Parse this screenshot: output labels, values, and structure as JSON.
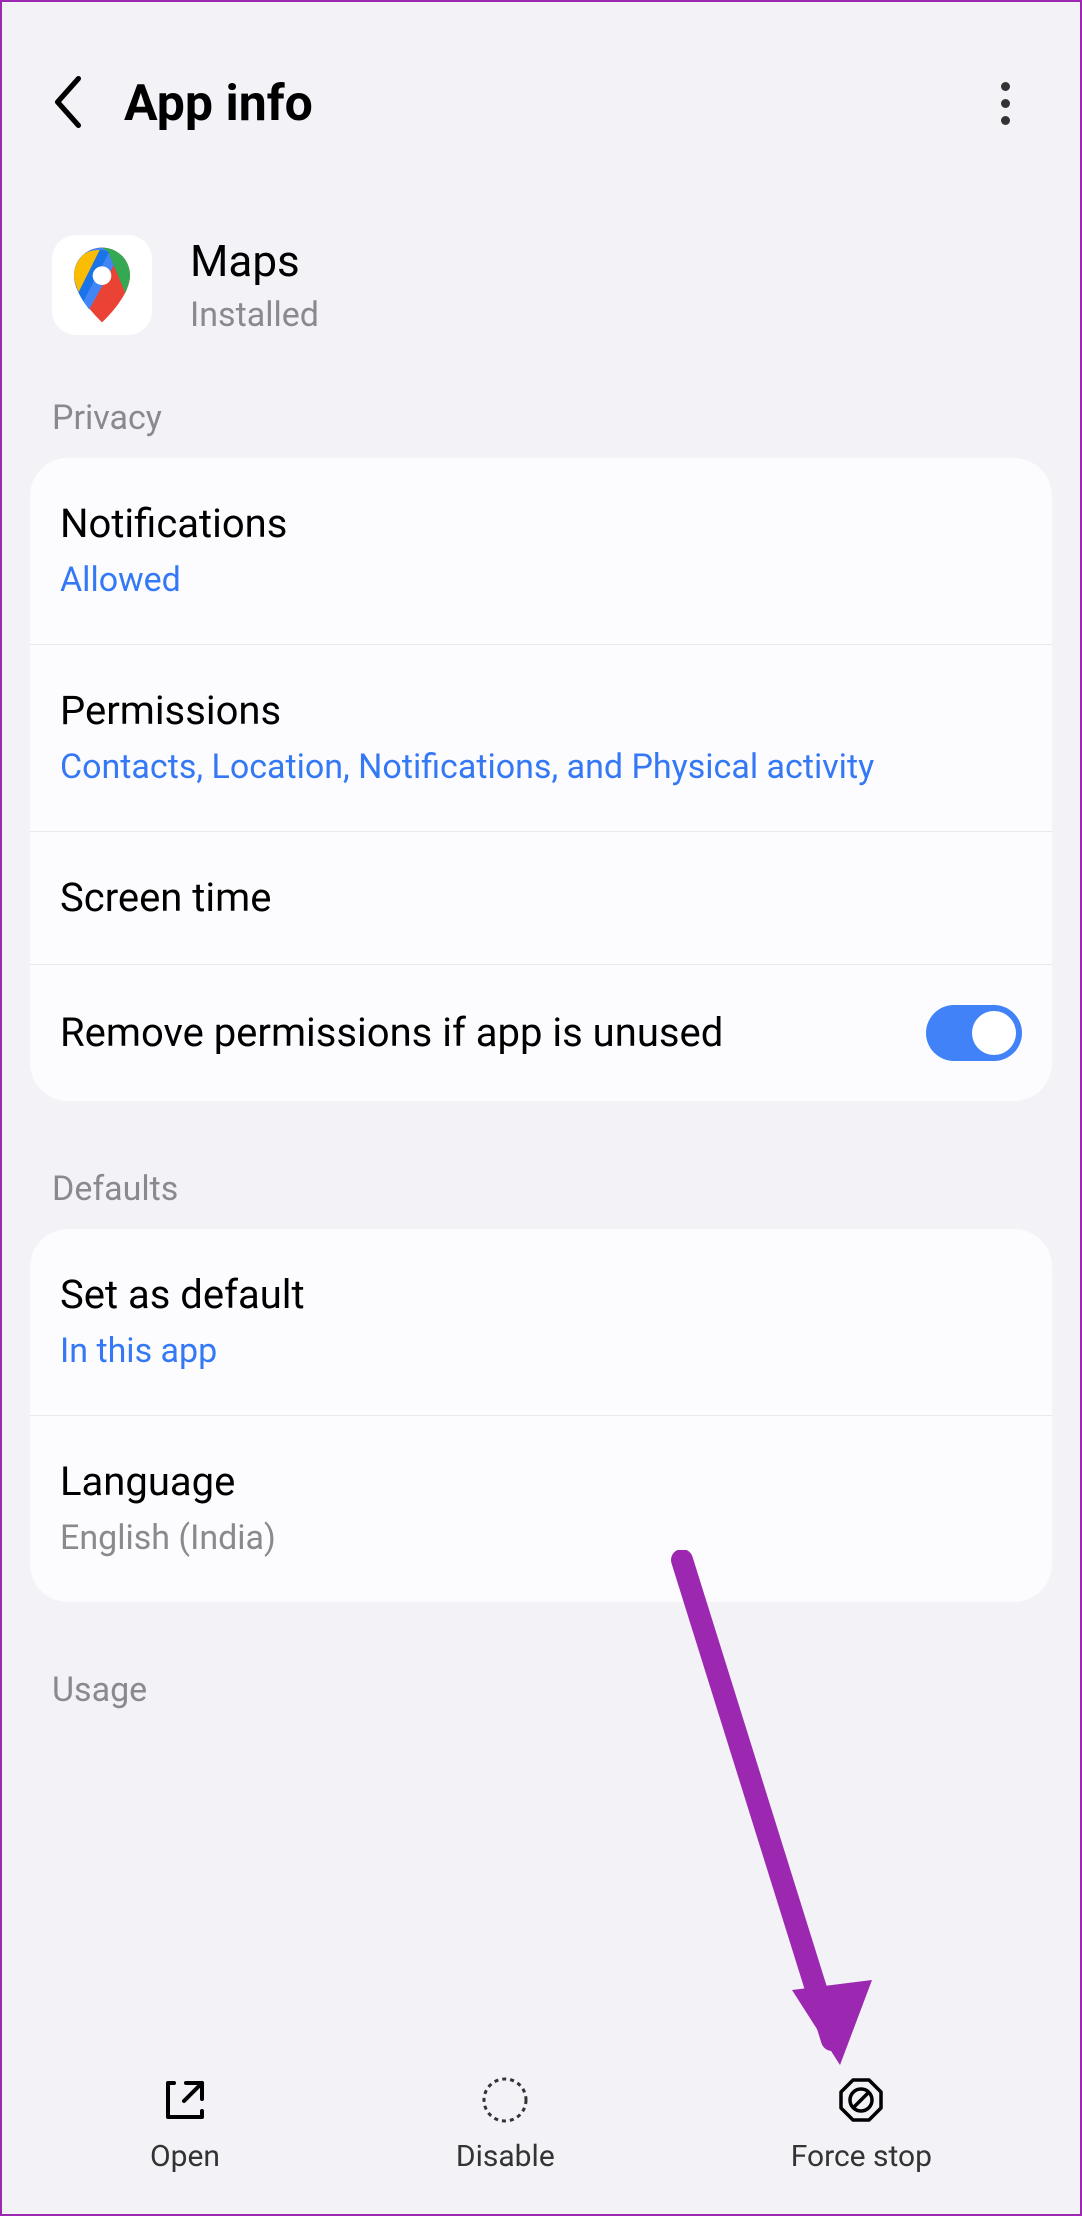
{
  "header": {
    "title": "App info"
  },
  "app": {
    "name": "Maps",
    "status": "Installed"
  },
  "sections": {
    "privacy": {
      "label": "Privacy",
      "notifications": {
        "title": "Notifications",
        "value": "Allowed"
      },
      "permissions": {
        "title": "Permissions",
        "value": "Contacts, Location, Notifications, and Physical activity"
      },
      "screen_time": {
        "title": "Screen time"
      },
      "remove_perms": {
        "title": "Remove permissions if app is unused",
        "enabled": true
      }
    },
    "defaults": {
      "label": "Defaults",
      "set_default": {
        "title": "Set as default",
        "value": "In this app"
      },
      "language": {
        "title": "Language",
        "value": "English (India)"
      }
    },
    "usage": {
      "label": "Usage"
    }
  },
  "bottom": {
    "open": "Open",
    "disable": "Disable",
    "force_stop": "Force stop"
  }
}
